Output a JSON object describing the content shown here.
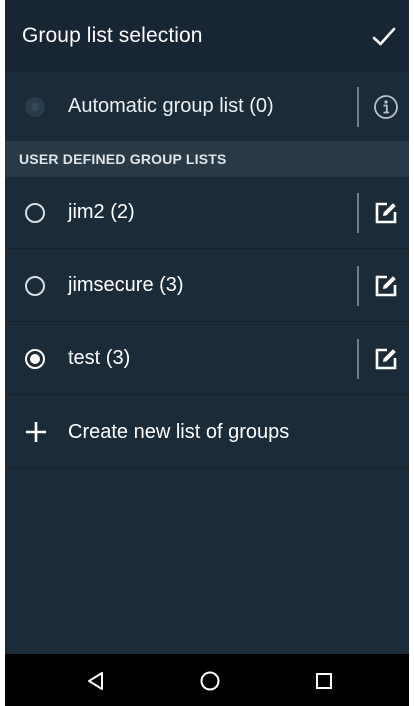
{
  "topbar": {
    "title": "Group list selection",
    "confirm_icon": "checkmark-icon"
  },
  "automatic": {
    "label": "Automatic group list (0)",
    "selected": false,
    "enabled": false,
    "info_icon": "info-icon"
  },
  "section": {
    "header": "USER DEFINED GROUP LISTS"
  },
  "group_lists": [
    {
      "label": "jim2 (2)",
      "selected": false,
      "edit_icon": "edit-icon"
    },
    {
      "label": "jimsecure (3)",
      "selected": false,
      "edit_icon": "edit-icon"
    },
    {
      "label": "test (3)",
      "selected": true,
      "edit_icon": "edit-icon"
    }
  ],
  "create": {
    "label": "Create new list of groups",
    "icon": "plus-icon"
  },
  "navbar": {
    "back_icon": "back-triangle-icon",
    "home_icon": "home-circle-icon",
    "recents_icon": "recents-square-icon"
  },
  "colors": {
    "background": "#1c2b38",
    "topbar": "#182532",
    "section_header": "#2a3946",
    "navbar": "#000000",
    "text": "#ffffff"
  }
}
